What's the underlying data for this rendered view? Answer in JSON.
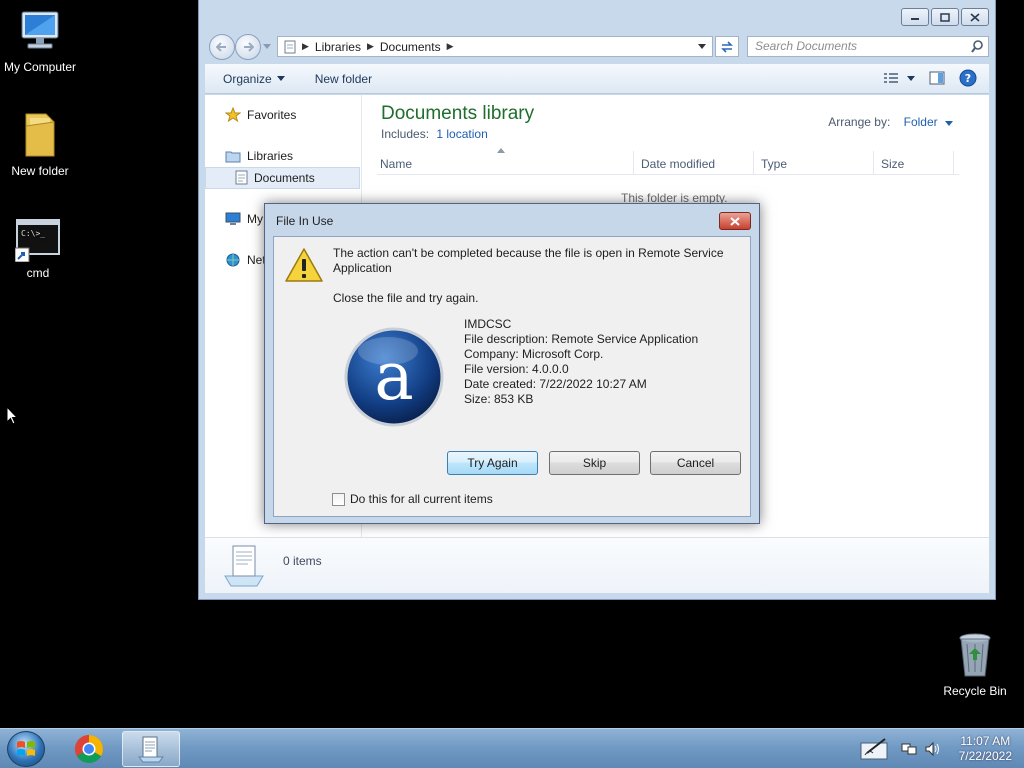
{
  "desktop": {
    "icons": [
      {
        "label": "My Computer"
      },
      {
        "label": "New folder"
      },
      {
        "label": "cmd"
      },
      {
        "label": "Recycle Bin"
      }
    ]
  },
  "explorer": {
    "breadcrumb": [
      "Libraries",
      "Documents"
    ],
    "search_placeholder": "Search Documents",
    "toolbar": {
      "organize": "Organize",
      "new_folder": "New folder"
    },
    "nav": {
      "favorites": "Favorites",
      "libraries": "Libraries",
      "documents": "Documents",
      "my_computer_partial": "My",
      "network_partial": "Net"
    },
    "library_title": "Documents library",
    "includes_label": "Includes:",
    "includes_link": "1 location",
    "arrange_label": "Arrange by:",
    "arrange_value": "Folder",
    "columns": [
      "Name",
      "Date modified",
      "Type",
      "Size"
    ],
    "empty_message": "This folder is empty.",
    "item_count": "0 items"
  },
  "dialog": {
    "title": "File In Use",
    "message": "The action can't be completed because the file is open in Remote Service Application",
    "sub_message": "Close the file and try again.",
    "file_info": [
      "IMDCSC",
      "File description: Remote Service Application",
      "Company: Microsoft Corp.",
      "File version: 4.0.0.0",
      "Date created: 7/22/2022 10:27 AM",
      "Size: 853 KB"
    ],
    "buttons": {
      "try_again": "Try Again",
      "skip": "Skip",
      "cancel": "Cancel"
    },
    "checkbox_label": "Do this for all current items"
  },
  "taskbar": {
    "time": "11:07 AM",
    "date": "7/22/2022"
  },
  "colors": {
    "library_title": "#1e6e2c",
    "link": "#1f5fb0",
    "close_button": "#c8402e",
    "taskbar": "#6f98c2"
  }
}
